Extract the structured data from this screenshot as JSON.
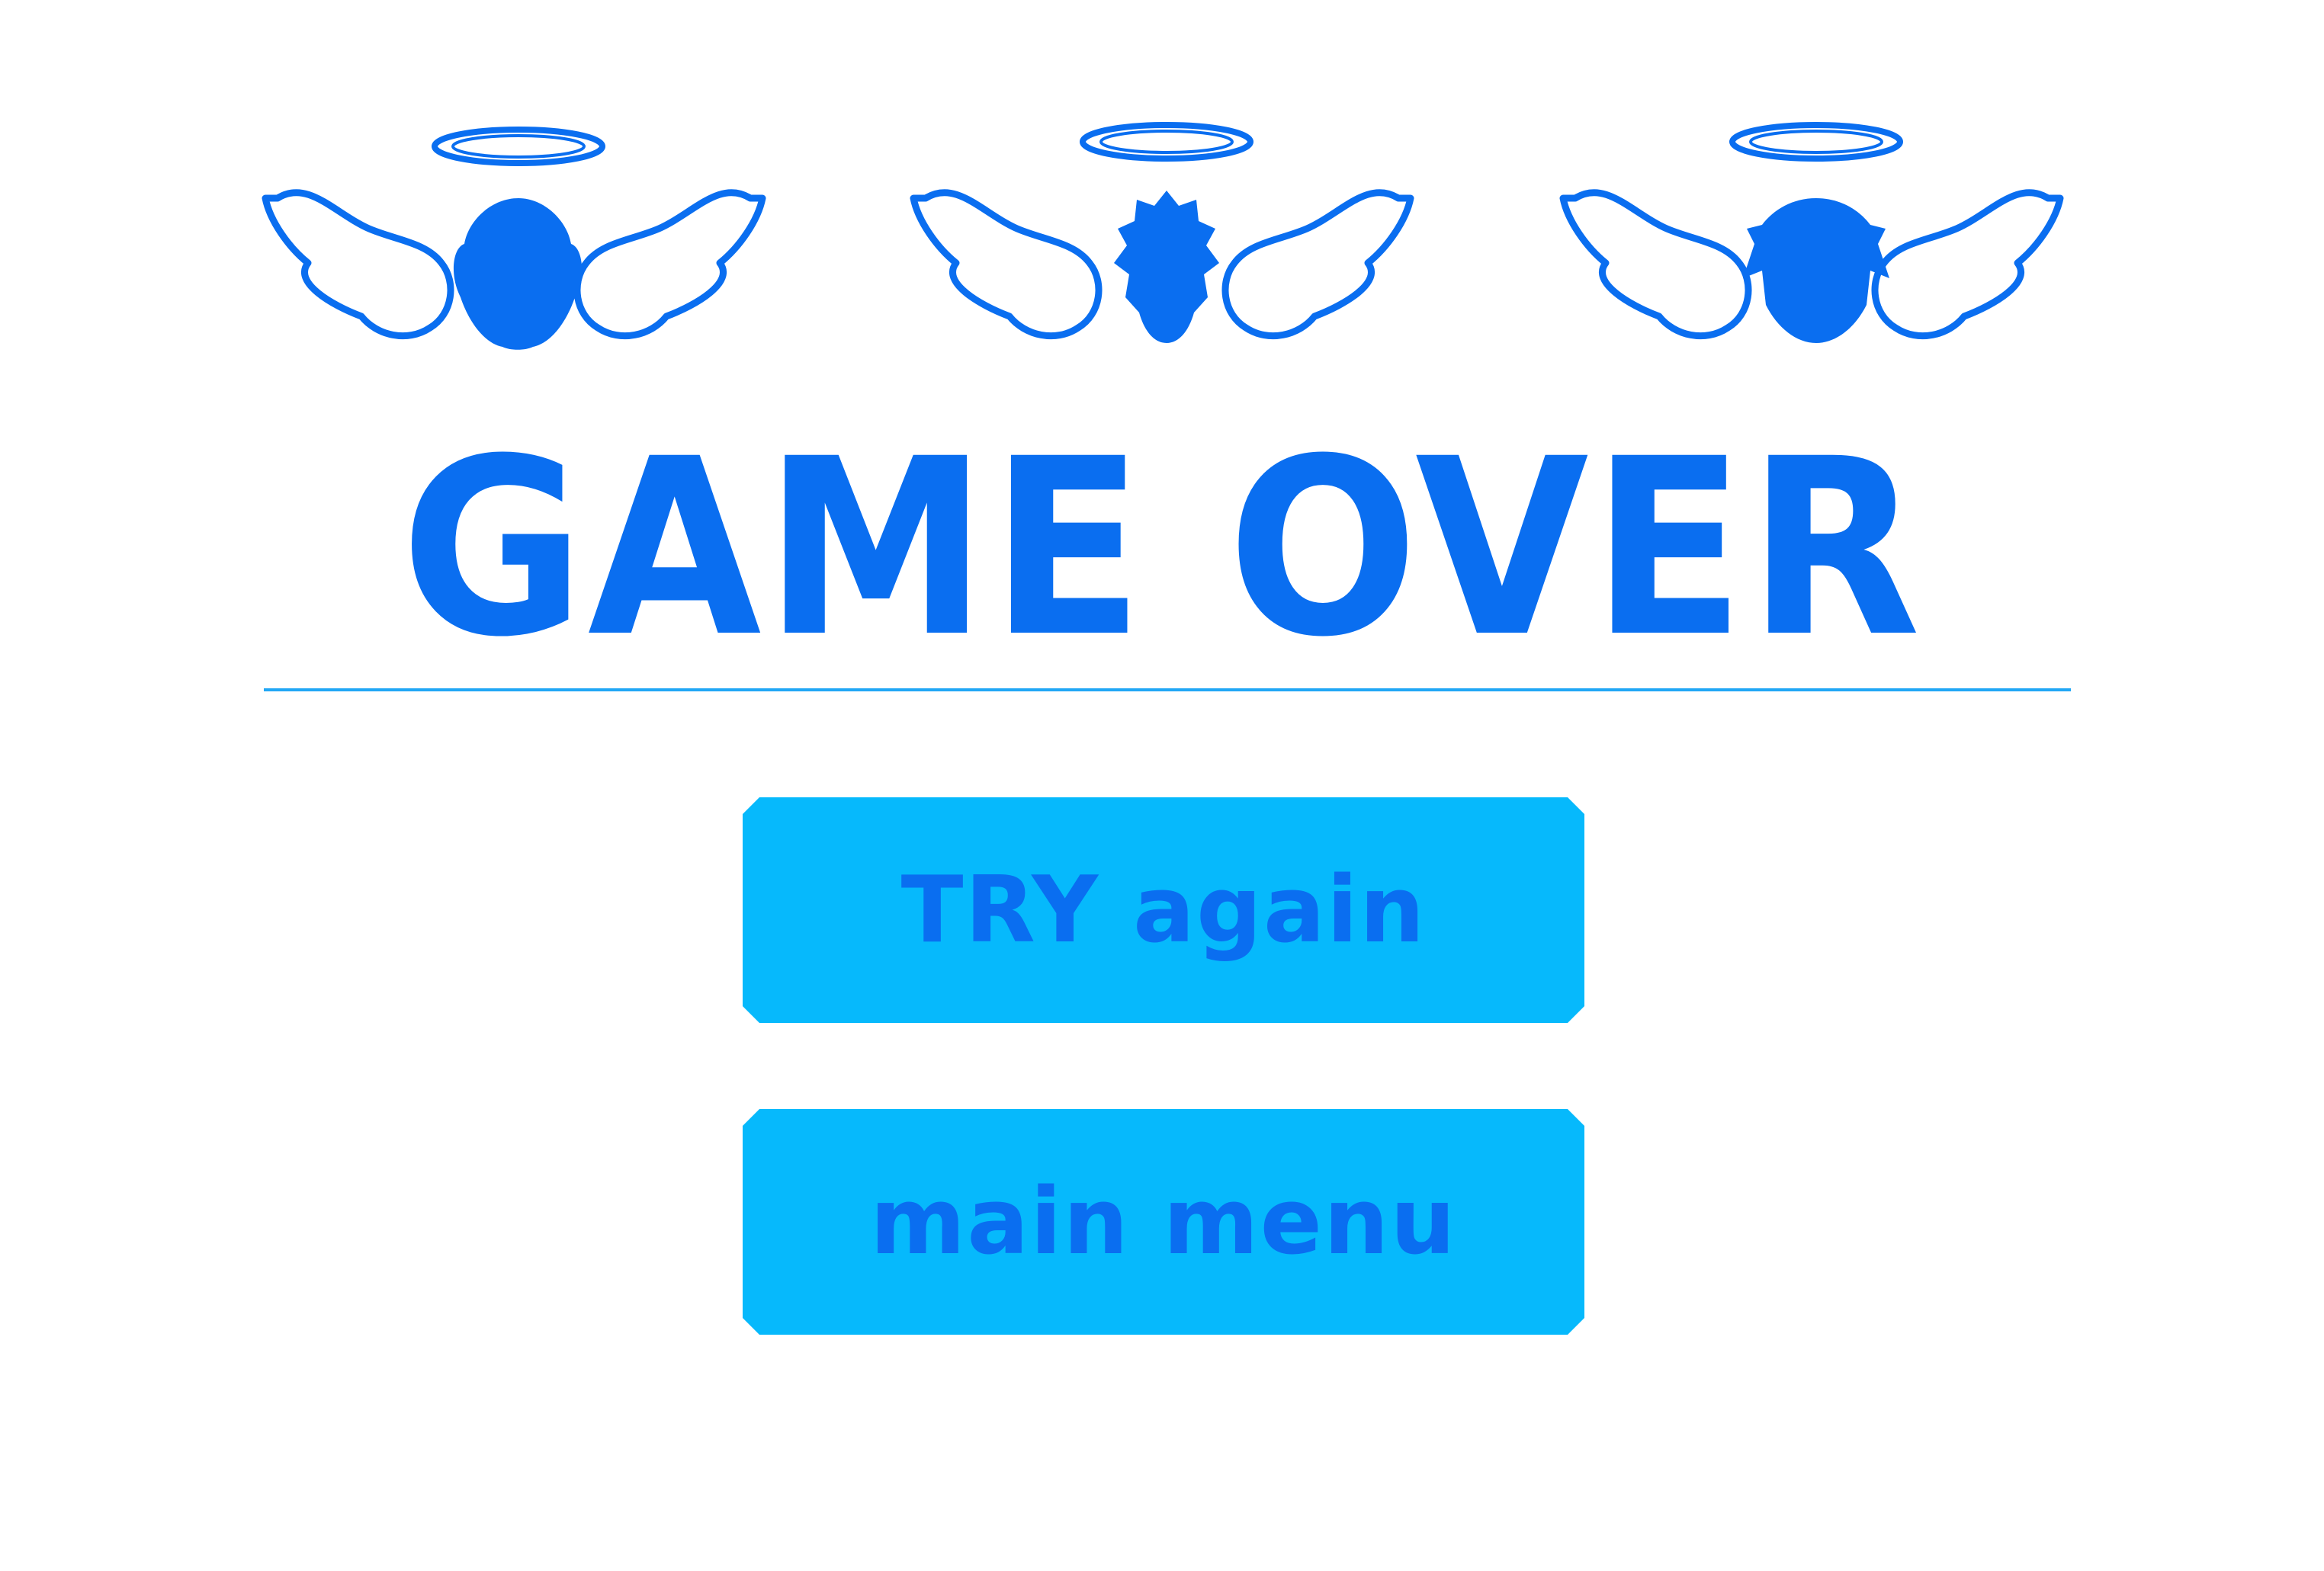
{
  "screen": {
    "title": "GAME OVER",
    "buttons": {
      "try_again": "TRY again",
      "main_menu": "main menu"
    }
  },
  "decor": {
    "icons": [
      "angel-icon",
      "angel-icon",
      "angel-icon"
    ],
    "colors": {
      "accent": "#0a6ef0",
      "button": "#06b9fc",
      "divider": "#21a7f5",
      "background": "#ffffff"
    }
  }
}
